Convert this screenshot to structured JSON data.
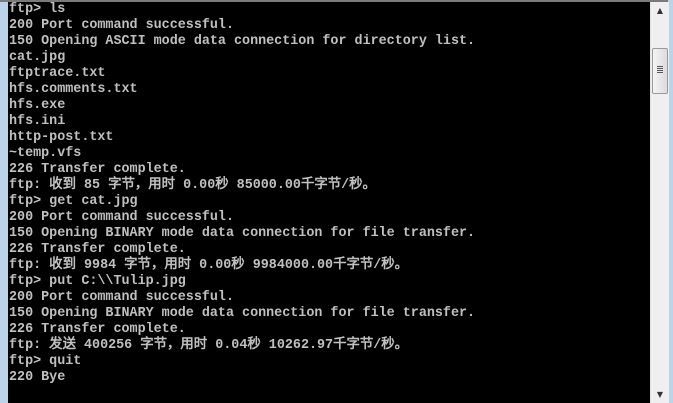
{
  "console": {
    "lines": [
      "ftp> ls",
      "200 Port command successful.",
      "150 Opening ASCII mode data connection for directory list.",
      "cat.jpg",
      "ftptrace.txt",
      "hfs.comments.txt",
      "hfs.exe",
      "hfs.ini",
      "http-post.txt",
      "~temp.vfs",
      "226 Transfer complete.",
      "ftp: 收到 85 字节，用时 0.00秒 85000.00千字节/秒。",
      "ftp> get cat.jpg",
      "200 Port command successful.",
      "150 Opening BINARY mode data connection for file transfer.",
      "226 Transfer complete.",
      "ftp: 收到 9984 字节，用时 0.00秒 9984000.00千字节/秒。",
      "ftp> put C:\\\\Tulip.jpg",
      "200 Port command successful.",
      "150 Opening BINARY mode data connection for file transfer.",
      "226 Transfer complete.",
      "ftp: 发送 400256 字节，用时 0.04秒 10262.97千字节/秒。",
      "ftp> quit",
      "220 Bye"
    ]
  },
  "scrollbar": {
    "up_glyph": "▲",
    "down_glyph": "▼",
    "position_fraction": 0.1
  }
}
